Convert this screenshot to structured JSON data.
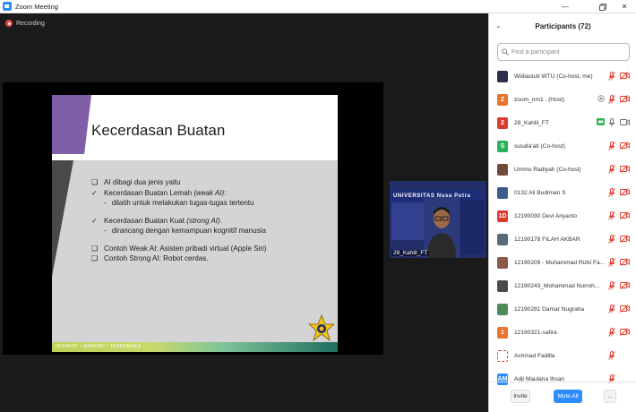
{
  "window": {
    "title": "Zoom Meeting"
  },
  "main": {
    "recording_label": "Recording",
    "slide": {
      "title": "Kecerdasan Buatan",
      "lines": [
        "AI dibagi dua jenis yaitu",
        "Kecerdasan Buatan Lemah",
        "(weak AI)",
        "dilatih untuk melakukan tugas-tugas tertentu",
        "Kecerdasan Buatan Kuat",
        "(strong AI)",
        "dirancang dengan kemampuan kognitif manusia",
        "Contoh Weak AI: Asisten pribadi virtual (Apple Siri)",
        "Contoh Strong AI: Robot cerdas."
      ],
      "footer": "INOVATIF • MANDIRI • TERKEMUKA"
    },
    "camera": {
      "banner_text": "UNIVERSITAS Nusa Putra",
      "name": "28_Kahlil_FT"
    }
  },
  "participants": {
    "title": "Participants (72)",
    "search_placeholder": "Find a participant",
    "rows": [
      {
        "initials": "",
        "name": "Widiastuti WTU (Co-host, me)",
        "avatar_color": "#2b2f4a"
      },
      {
        "initials": "Z",
        "name": "zoom_nm1 . (Host)",
        "avatar_color": "#e8742f"
      },
      {
        "initials": "2",
        "name": "28_Kahlil_FT",
        "avatar_color": "#dc3b2f"
      },
      {
        "initials": "S",
        "name": "susafa'ati (Co-host)",
        "avatar_color": "#29b15d"
      },
      {
        "initials": "",
        "name": "Ummu Radiyah (Co-host)",
        "avatar_color": "#6f4a3a"
      },
      {
        "initials": "",
        "name": "0132 Ali Budiman S",
        "avatar_color": "#3b5b8c"
      },
      {
        "initials": "1D",
        "name": "12190030 Devi Ariyanto",
        "avatar_color": "#e0392b"
      },
      {
        "initials": "",
        "name": "12190178 FILAH AKBAR",
        "avatar_color": "#5a6c7a"
      },
      {
        "initials": "",
        "name": "12190209 - Muhammad Rizki Fa...",
        "avatar_color": "#8a5a4a"
      },
      {
        "initials": "",
        "name": "12190243_Mohammad Nurroh...",
        "avatar_color": "#4a4a4a"
      },
      {
        "initials": "",
        "name": "12190281 Damar Nugraha",
        "avatar_color": "#4e8a5a"
      },
      {
        "initials": "1",
        "name": "12190321-safira",
        "avatar_color": "#e8742f"
      },
      {
        "initials": "",
        "name": "Achmad Fadilla",
        "avatar_color": "#ffffff"
      },
      {
        "initials": "AM",
        "name": "Adji Maulana Ihsan",
        "avatar_color": "#2D8CFF"
      }
    ],
    "invite_label": "Invite",
    "mute_all_label": "Mute All",
    "more_label": "..."
  },
  "colors": {
    "accent": "#2D8CFF",
    "muted_red": "#e0392b",
    "slide_purple": "#7f5fa8"
  }
}
